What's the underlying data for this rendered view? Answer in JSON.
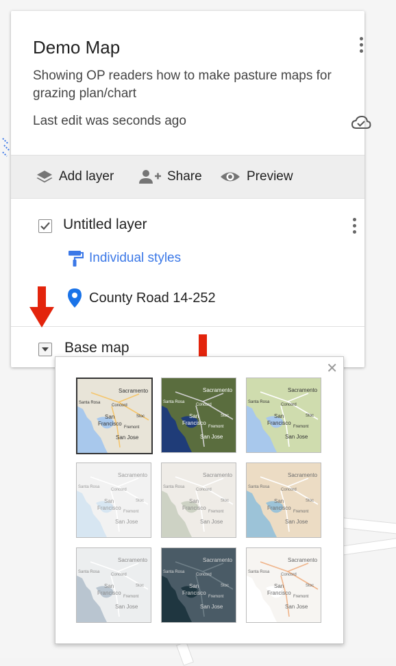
{
  "panel": {
    "title": "Demo Map",
    "description": "Showing OP readers how to make pasture maps for grazing plan/chart",
    "last_edit": "Last edit was seconds ago"
  },
  "toolbar": {
    "add_layer": "Add layer",
    "share": "Share",
    "preview": "Preview"
  },
  "layer": {
    "name": "Untitled layer",
    "styles": "Individual styles",
    "place": "County Road 14-252",
    "checked": true
  },
  "basemap": {
    "label": "Base map",
    "tiles": [
      {
        "name": "map",
        "land": "#e8e4d8",
        "water": "#a8c8ec",
        "text": "#333333",
        "road": "#f5c56b"
      },
      {
        "name": "satellite",
        "land": "#5a6d3e",
        "water": "#1f3c78",
        "text": "#ffffff",
        "road": "#d0d0d0"
      },
      {
        "name": "terrain",
        "land": "#cfdcae",
        "water": "#a8c8ec",
        "text": "#333333",
        "road": "#ffffff"
      },
      {
        "name": "light-political",
        "land": "#f2f2f2",
        "water": "#d7e6f2",
        "text": "#9a9a9a",
        "road": "#ffffff"
      },
      {
        "name": "mono-city",
        "land": "#efece7",
        "water": "#cdd2c4",
        "text": "#8c8c8c",
        "road": "#ffffff"
      },
      {
        "name": "simple-atlas",
        "land": "#ecdcc4",
        "water": "#9cc3d8",
        "text": "#6c6c6c",
        "road": "#ffffff"
      },
      {
        "name": "light-landmass",
        "land": "#eceeef",
        "water": "#b9c5d0",
        "text": "#8a8a8a",
        "road": "#ffffff"
      },
      {
        "name": "dark-landmass",
        "land": "#4a5b66",
        "water": "#1f3640",
        "text": "#d8d8d8",
        "road": "#6f7f88"
      },
      {
        "name": "whitewater",
        "land": "#f7f5f2",
        "water": "#ffffff",
        "text": "#666666",
        "road": "#f0b48a"
      }
    ],
    "tile_labels": {
      "sacramento": "Sacramento",
      "santa_rosa": "Santa Rosa",
      "concord": "Concord",
      "san": "San",
      "francisco": "Francisco",
      "stockton": "Stoc",
      "fremont": "Fremont",
      "san_jose": "San Jose"
    }
  },
  "colors": {
    "accent": "#3b78e7",
    "pin": "#1a73e8",
    "annotation_arrow": "#e3240c"
  },
  "icons": [
    "more-vert-icon",
    "cloud-done-icon",
    "layers-icon",
    "person-add-icon",
    "eye-icon",
    "paint-roller-icon",
    "place-pin-icon",
    "close-icon",
    "annotation-arrow-icon"
  ]
}
